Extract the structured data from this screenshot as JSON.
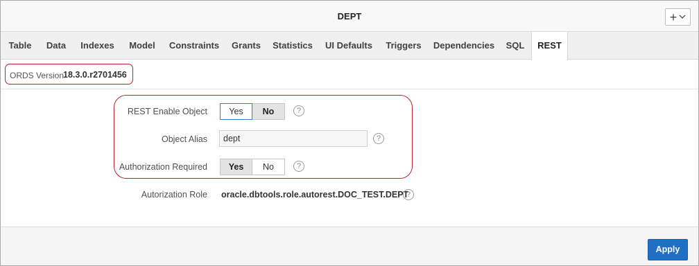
{
  "window": {
    "title": "DEPT",
    "add_button": "+"
  },
  "tabs": [
    {
      "label": "Table"
    },
    {
      "label": "Data"
    },
    {
      "label": "Indexes"
    },
    {
      "label": "Model"
    },
    {
      "label": "Constraints"
    },
    {
      "label": "Grants"
    },
    {
      "label": "Statistics"
    },
    {
      "label": "UI Defaults"
    },
    {
      "label": "Triggers"
    },
    {
      "label": "Dependencies"
    },
    {
      "label": "SQL"
    },
    {
      "label": "REST"
    }
  ],
  "active_tab": "REST",
  "ords": {
    "label": "ORDS Version",
    "value": "18.3.0.r2701456"
  },
  "form": {
    "rest_enable": {
      "label": "REST Enable Object",
      "options": [
        "Yes",
        "No"
      ],
      "selected": "No"
    },
    "object_alias": {
      "label": "Object Alias",
      "value": "dept"
    },
    "auth_required": {
      "label": "Authorization Required",
      "options": [
        "Yes",
        "No"
      ],
      "selected": "Yes"
    },
    "auth_role": {
      "label": "Autorization Role",
      "value": "oracle.dbtools.role.autorest.DOC_TEST.DEPT"
    },
    "help_symbol": "?"
  },
  "footer": {
    "apply_label": "Apply"
  },
  "colors": {
    "accent": "#1f6fc5",
    "highlight_border": "#c0202a"
  }
}
